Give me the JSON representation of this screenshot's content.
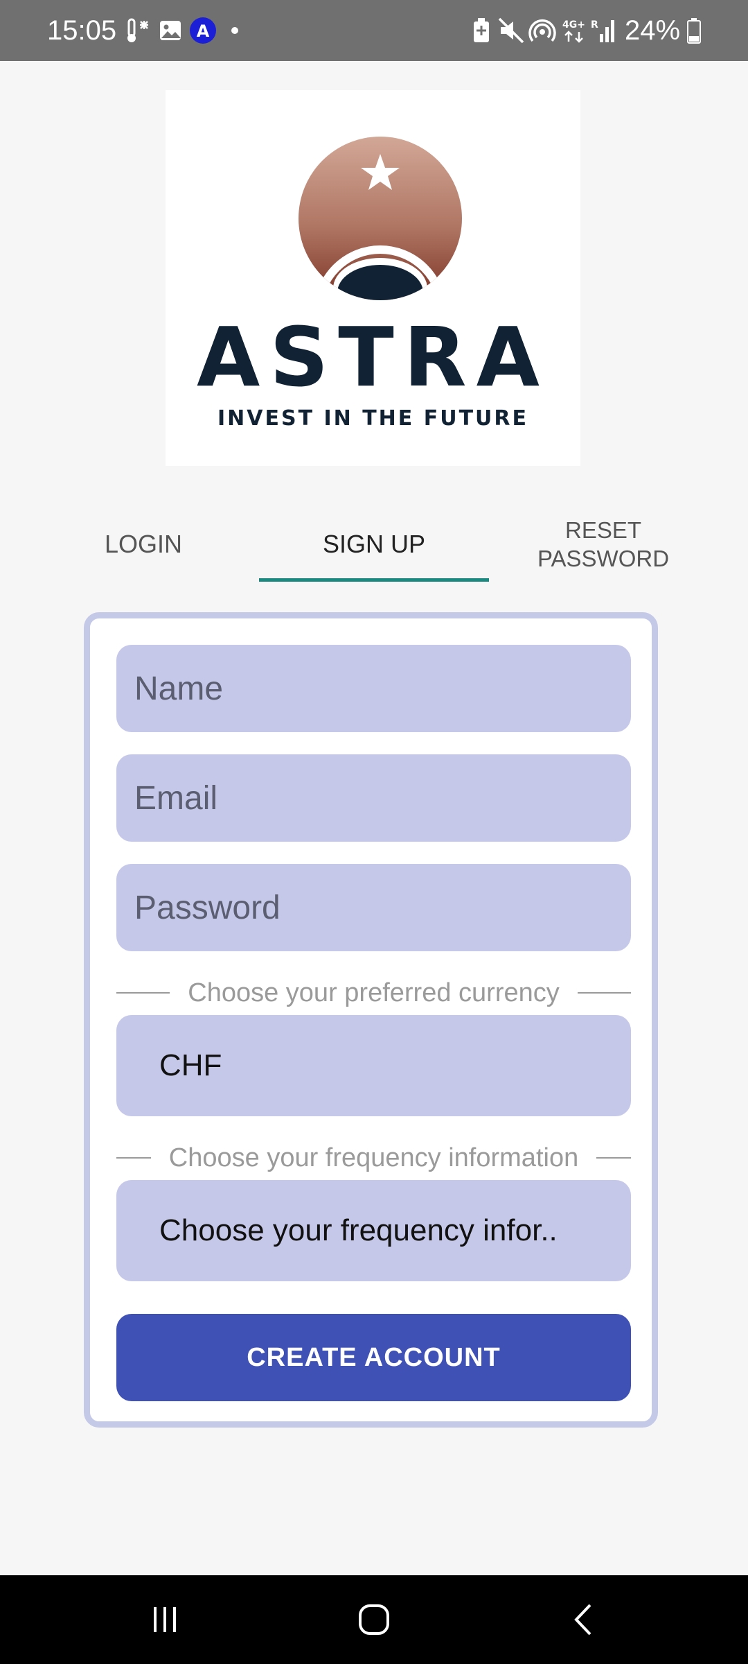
{
  "status_bar": {
    "time": "15:05",
    "battery_percent": "24%",
    "left_icons": [
      "thermometer-icon",
      "image-icon",
      "app-a-icon",
      "dot-icon"
    ],
    "right_icons": [
      "battery-saver-icon",
      "mute-icon",
      "hotspot-icon",
      "4g-icon",
      "signal-icon",
      "battery-icon"
    ],
    "app_icon_letter": "A",
    "network_label": "4G+"
  },
  "logo": {
    "wordmark": "ASTRA",
    "tagline": "INVEST IN THE FUTURE",
    "colors": {
      "navy": "#102233",
      "copper_top": "#c99a88",
      "copper_bottom": "#7c3426"
    }
  },
  "tabs": [
    {
      "label": "LOGIN",
      "selected": false
    },
    {
      "label": "SIGN UP",
      "selected": true
    },
    {
      "label": "RESET PASSWORD",
      "selected": false
    }
  ],
  "form": {
    "name_placeholder": "Name",
    "email_placeholder": "Email",
    "password_placeholder": "Password",
    "currency_label": "Choose your preferred currency",
    "currency_value": "CHF",
    "frequency_label": "Choose your frequency information",
    "frequency_value": "Choose your frequency infor..",
    "submit_label": "CREATE ACCOUNT"
  },
  "theme": {
    "accent": "#3f51b5",
    "field_bg": "#c5c8e9",
    "tab_indicator": "#1a8a80"
  },
  "nav_bar": {
    "icons": [
      "recent-apps-icon",
      "home-icon",
      "back-icon"
    ]
  }
}
